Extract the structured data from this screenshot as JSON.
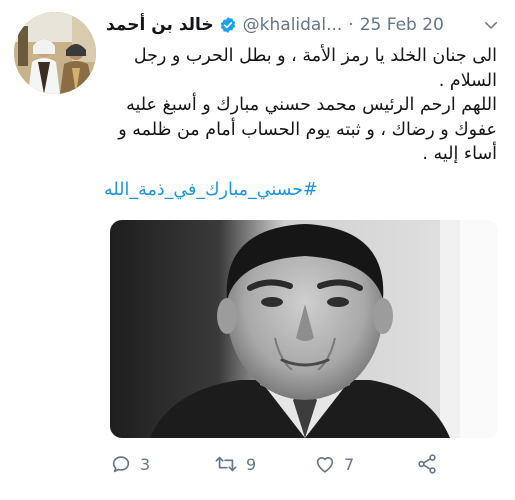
{
  "tweet": {
    "display_name": "خالد بن أحمد",
    "handle": "@khalidal...",
    "separator": "·",
    "date": "25 Feb 20",
    "lines": [
      "الى جنان الخلد  يا رمز الأمة ، و بطل الحرب و رجل السلام .",
      "اللهم ارحم الرئيس محمد حسني مبارك و أسبغ عليه عفوك و رضاك ، و ثبته يوم الحساب أمام من ظلمه و أساء إليه ."
    ],
    "hashtag": "#حسني_مبارك_في_ذمة_الله"
  },
  "actions": {
    "reply_count": "3",
    "retweet_count": "9",
    "like_count": "7"
  },
  "icons": {
    "verified": "verified-badge-icon",
    "menu": "chevron-down-icon",
    "reply": "reply-icon",
    "retweet": "retweet-icon",
    "like": "heart-icon",
    "share": "share-icon"
  },
  "colors": {
    "accent": "#1b95e0",
    "secondary_text": "#657786",
    "primary_text": "#14171a"
  }
}
